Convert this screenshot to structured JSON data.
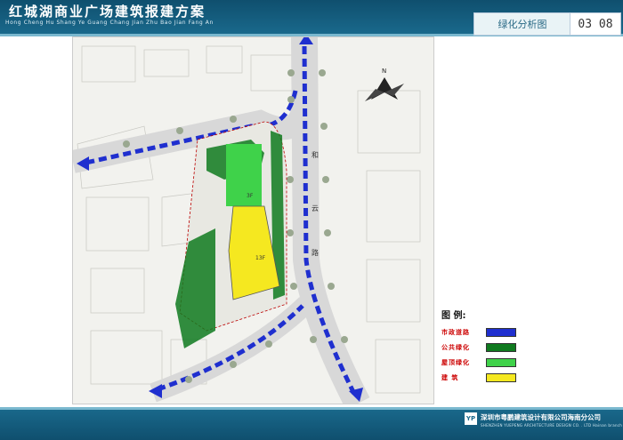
{
  "header": {
    "title_cn": "红城湖商业广场建筑报建方案",
    "title_pinyin": "Hong Cheng Hu Shang Ye Guang Chang Jian Zhu Bao Jian Fang An",
    "sheet_title": "绿化分析图",
    "sheet_number": "03 08"
  },
  "plan": {
    "road_labels": [
      "和",
      "云",
      "路"
    ],
    "north_label": "N",
    "building_labels": [
      "3F",
      "13F"
    ],
    "annotation_text": "和云路"
  },
  "legend": {
    "title": "图 例:",
    "items": [
      {
        "label": "市政道路",
        "color": "#1f2fcf"
      },
      {
        "label": "公共绿化",
        "color": "#0f7a1f"
      },
      {
        "label": "屋顶绿化",
        "color": "#3fd24a"
      },
      {
        "label": "建  筑",
        "color": "#f5e820"
      }
    ]
  },
  "footer": {
    "logo": "YP",
    "company_cn": "深圳市粤鹏建筑设计有限公司海南分公司",
    "company_en": "SHENZHEN YUEPENG ARCHITECTURE DESIGN CO. . LTD Hainan branch"
  }
}
